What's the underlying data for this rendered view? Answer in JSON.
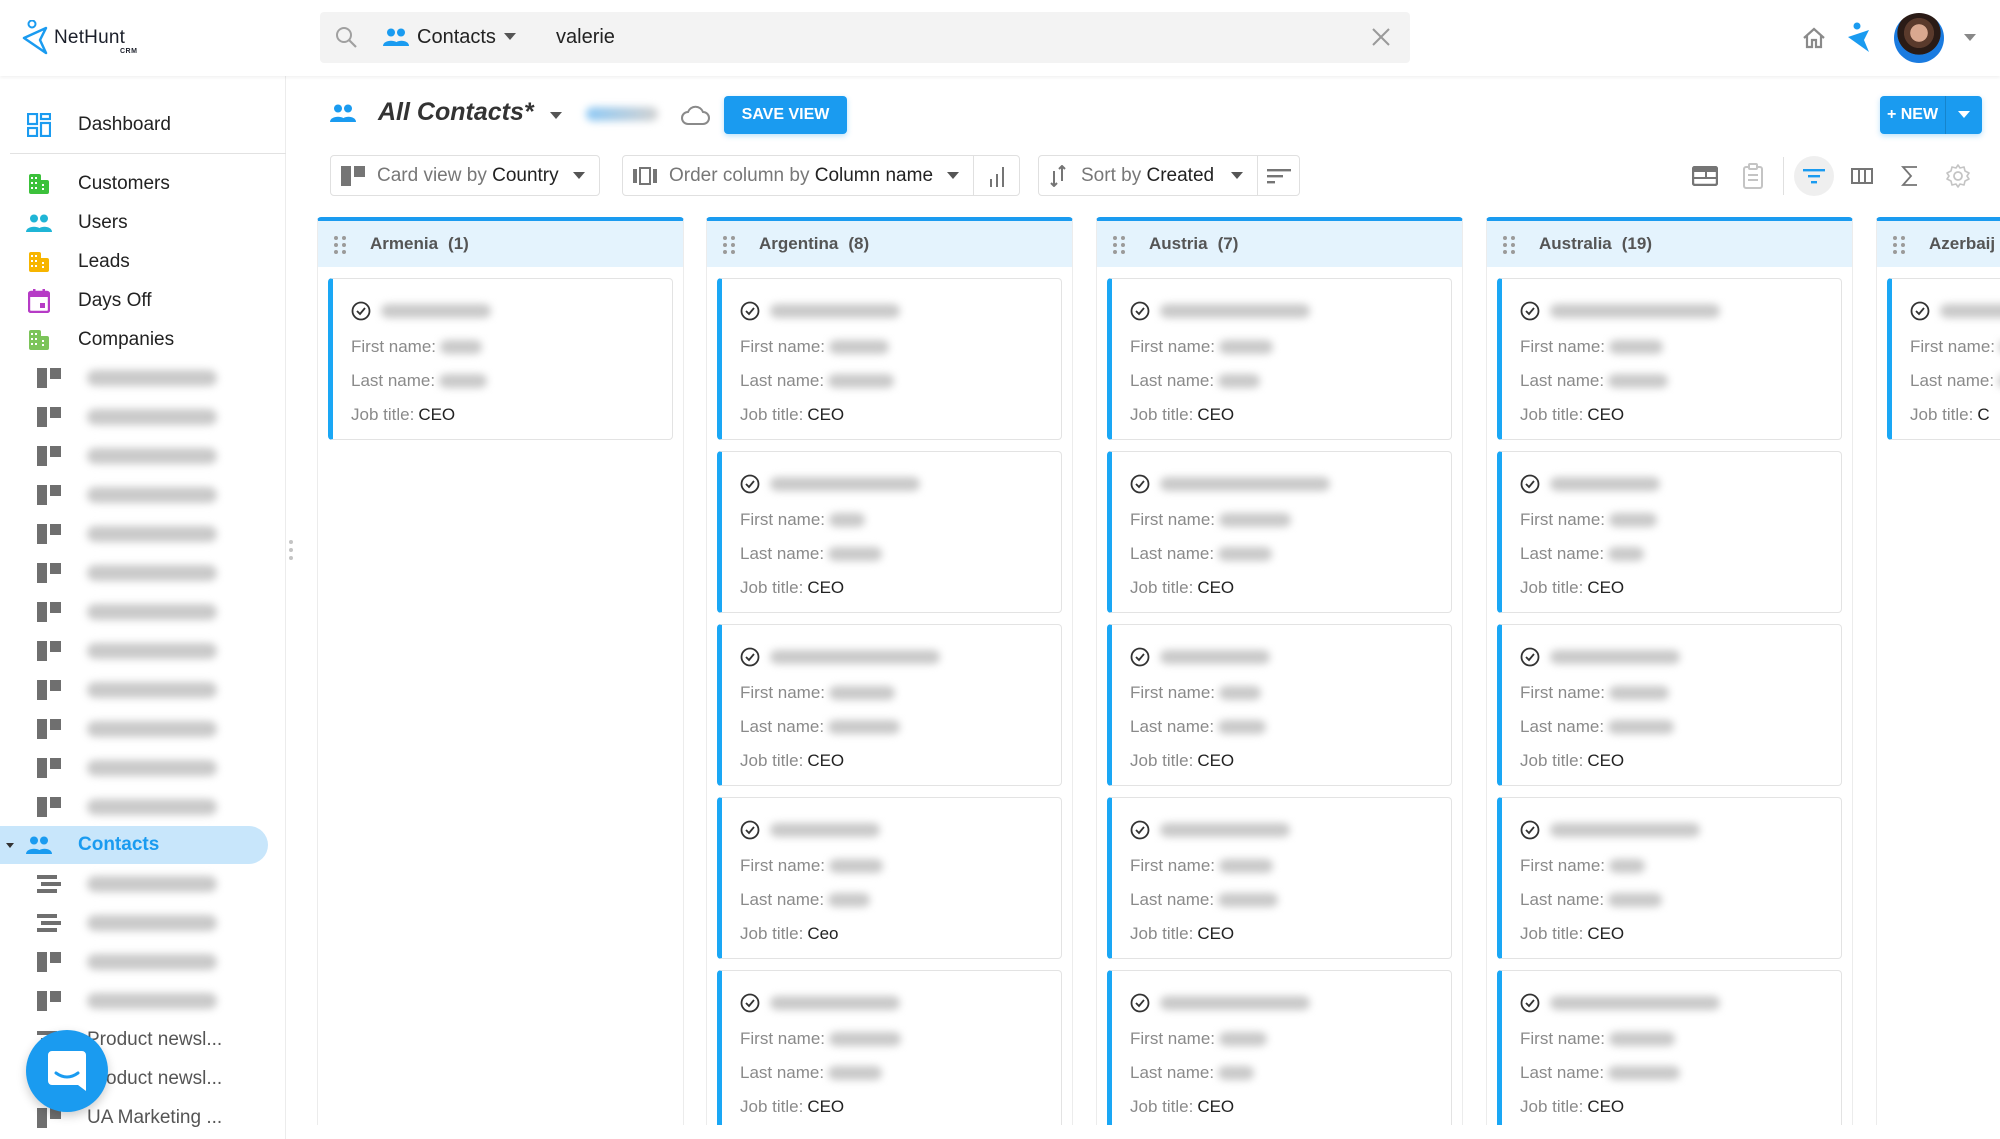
{
  "app": {
    "logo_text": "NetHunt",
    "logo_sub": "CRM"
  },
  "topbar": {
    "search_entity": "Contacts",
    "search_query": "valerie",
    "icons": [
      "search-icon",
      "contacts-icon",
      "caret-down-icon",
      "close-icon",
      "home-icon",
      "nethunt-icon",
      "avatar",
      "caret-down-icon"
    ]
  },
  "sidebar": {
    "dashboard": "Dashboard",
    "folders": [
      {
        "label": "Customers",
        "icon": "building-icon",
        "color": "#3cc13b"
      },
      {
        "label": "Users",
        "icon": "people-icon",
        "color": "#1fb5d6"
      },
      {
        "label": "Leads",
        "icon": "building-icon",
        "color": "#f7b500"
      },
      {
        "label": "Days Off",
        "icon": "calendar-icon",
        "color": "#b63bc6"
      },
      {
        "label": "Companies",
        "icon": "building-icon",
        "color": "#7cc45a"
      }
    ],
    "company_views": [
      {
        "label": "Lab Partners p...",
        "icon": "board-view-icon",
        "blurred": true
      },
      {
        "label": "General sales ...",
        "icon": "board-view-icon",
        "blurred": true
      },
      {
        "label": "Sales pipeline...",
        "icon": "board-view-icon",
        "blurred": true
      },
      {
        "label": "Sales pipeline...",
        "icon": "board-view-icon",
        "blurred": true
      },
      {
        "label": "Sales pipeline...",
        "icon": "board-view-icon",
        "blurred": true
      },
      {
        "label": "Sales pipeline...",
        "icon": "board-view-icon",
        "blurred": true
      },
      {
        "label": "Sales pipeline...",
        "icon": "board-view-icon",
        "blurred": true
      },
      {
        "label": "Sales pipeline...",
        "icon": "board-view-icon",
        "blurred": true
      },
      {
        "label": "SDR pipeline",
        "icon": "board-view-icon",
        "blurred": true
      },
      {
        "label": "Sales WestLo...",
        "icon": "board-view-icon",
        "blurred": true
      },
      {
        "label": "Zhenya SDR p...",
        "icon": "board-view-icon",
        "blurred": true
      },
      {
        "label": "Sales lost last...",
        "icon": "board-view-icon",
        "blurred": true
      }
    ],
    "active": "Contacts",
    "contact_views": [
      {
        "label": "CRM Lab new...",
        "icon": "list-view-icon",
        "blurred": true
      },
      {
        "label": "CRM Lab new...",
        "icon": "list-view-icon",
        "blurred": true
      },
      {
        "label": "MQLs - by sou...",
        "icon": "board-view-icon",
        "blurred": true
      },
      {
        "label": "Startup Plan -...",
        "icon": "board-view-icon",
        "blurred": true
      },
      {
        "label": "Product newsl...",
        "icon": "list-view-icon",
        "blurred": false
      },
      {
        "label": "Product newsl...",
        "icon": "list-view-icon",
        "blurred": false
      },
      {
        "label": "UA Marketing ...",
        "icon": "board-view-icon",
        "blurred": false
      }
    ]
  },
  "view": {
    "title": "All Contacts*",
    "save_view": "SAVE VIEW",
    "new_button": "+ NEW",
    "card_view_prefix": "Card view by ",
    "card_view_field": "Country",
    "order_prefix": "Order column by ",
    "order_field": "Column name",
    "sort_prefix": "Sort by ",
    "sort_field": "Created",
    "right_tools": [
      "layout-icon",
      "clipboard-icon",
      "filter-icon",
      "columns-icon",
      "sum-icon",
      "gear-icon"
    ],
    "accent": "#1a9bf0"
  },
  "board": {
    "field_labels": {
      "first": "First name:",
      "last": "Last name:",
      "job": "Job title:"
    },
    "columns": [
      {
        "name": "Armenia",
        "count": "(1)",
        "cards": [
          {
            "job": "CEO"
          }
        ]
      },
      {
        "name": "Argentina",
        "count": "(8)",
        "cards": [
          {
            "job": "CEO"
          },
          {
            "job": "CEO"
          },
          {
            "job": "CEO"
          },
          {
            "job": "Ceo"
          },
          {
            "job": "CEO"
          }
        ]
      },
      {
        "name": "Austria",
        "count": "(7)",
        "cards": [
          {
            "job": "CEO"
          },
          {
            "job": "CEO"
          },
          {
            "job": "CEO"
          },
          {
            "job": "CEO"
          },
          {
            "job": "CEO"
          }
        ]
      },
      {
        "name": "Australia",
        "count": "(19)",
        "cards": [
          {
            "job": "CEO"
          },
          {
            "job": "CEO"
          },
          {
            "job": "CEO"
          },
          {
            "job": "CEO"
          },
          {
            "job": "CEO"
          }
        ]
      },
      {
        "name": "Azerbaij",
        "count": "",
        "cards": [
          {
            "job": "C"
          }
        ]
      }
    ]
  }
}
